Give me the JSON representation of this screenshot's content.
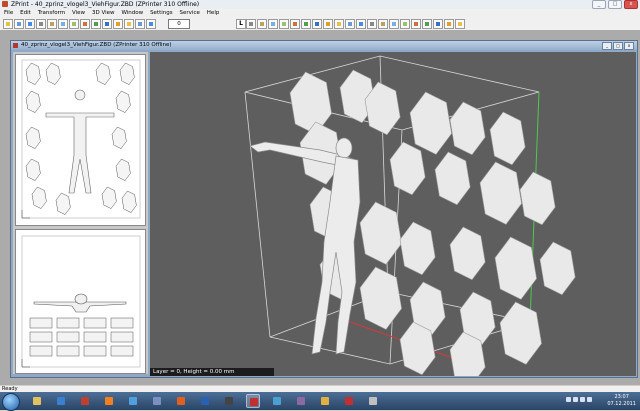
{
  "window": {
    "title": "ZPrint - 40_zprinz_vlogel3_ViehFigur.ZBD (ZPrinter 310 Offline)",
    "controls": {
      "minimize": "_",
      "maximize": "□",
      "close": "x"
    }
  },
  "menu": [
    "File",
    "Edit",
    "Transform",
    "View",
    "3D View",
    "Window",
    "Settings",
    "Service",
    "Help"
  ],
  "toolbar": {
    "layer_value": "0",
    "layer_button": "L",
    "icons": [
      "new-icon",
      "open-icon",
      "save-icon",
      "print-icon",
      "cut-icon",
      "copy-icon",
      "paste-icon",
      "undo-icon",
      "redo-icon",
      "select-icon",
      "move-icon",
      "rotate-icon",
      "scale-icon",
      "delete-icon",
      "layer-down-icon",
      "layer-up-icon",
      "slice-icon",
      "view-top-icon",
      "view-front-icon",
      "view-right-icon",
      "view-iso-icon",
      "zoom-in-icon",
      "zoom-out-icon",
      "zoom-all-icon",
      "fit-icon",
      "pan-icon",
      "orbit-icon",
      "shade-icon",
      "wire-icon",
      "bound-icon",
      "collide-icon",
      "pack-icon",
      "color-icon",
      "help-icon"
    ]
  },
  "document": {
    "title": "40_zprinz_vlogel3_ViehFigur.ZBD (ZPrinter 310 Offline)"
  },
  "viewport": {
    "status": "Layer = 0, Height = 0.00 mm",
    "background": "#5e5e5e",
    "model_color": "#e8e8e8"
  },
  "statusbar": {
    "text": "Ready"
  },
  "taskbar": {
    "clock_time": "23:07",
    "clock_date": "07.12.2011",
    "apps": [
      "explorer-icon",
      "media-player-icon",
      "recorder-icon",
      "vlc-icon",
      "network-icon",
      "users-icon",
      "firefox-icon",
      "virtualbox-icon",
      "terminal-icon",
      "zprint-icon",
      "charts-icon",
      "tool-icon",
      "folder-icon",
      "record-icon",
      "scrap-icon"
    ]
  }
}
